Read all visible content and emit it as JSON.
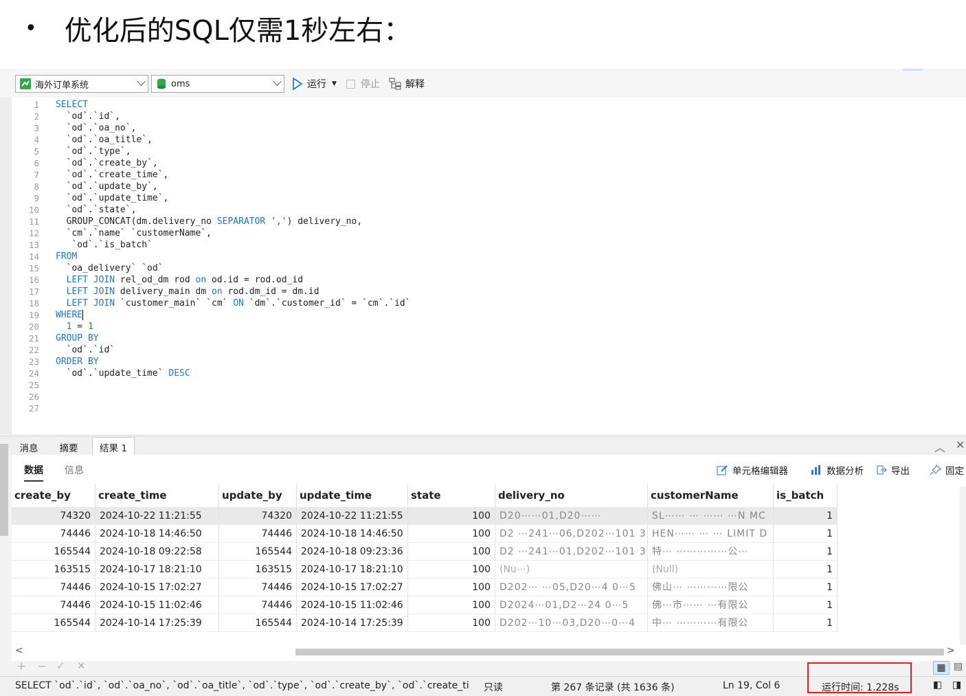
{
  "slide": {
    "bullet": "•",
    "title": "优化后的SQL仅需1秒左右："
  },
  "toolbar": {
    "connection": "海外订单系统",
    "database": "oms",
    "run": "运行",
    "stop": "停止",
    "explain": "解释"
  },
  "editor": {
    "line_numbers": [
      "1",
      "2",
      "3",
      "4",
      "5",
      "6",
      "7",
      "8",
      "9",
      "10",
      "11",
      "12",
      "13",
      "14",
      "15",
      "16",
      "17",
      "18",
      "19",
      "20",
      "21",
      "22",
      "23",
      "24",
      "25",
      "26",
      "27"
    ],
    "lines": [
      [
        {
          "t": "SELECT",
          "c": "kw"
        }
      ],
      [
        {
          "t": "  `od`.`id`,",
          "c": ""
        }
      ],
      [
        {
          "t": "  `od`.`oa_no`,",
          "c": ""
        }
      ],
      [
        {
          "t": "  `od`.`oa_title`,",
          "c": ""
        }
      ],
      [
        {
          "t": "  `od`.`type`,",
          "c": ""
        }
      ],
      [
        {
          "t": "  `od`.`create_by`,",
          "c": ""
        }
      ],
      [
        {
          "t": "  `od`.`create_time`,",
          "c": ""
        }
      ],
      [
        {
          "t": "  `od`.`update_by`,",
          "c": ""
        }
      ],
      [
        {
          "t": "  `od`.`update_time`,",
          "c": ""
        }
      ],
      [
        {
          "t": "  `od`.`state`,",
          "c": ""
        }
      ],
      [
        {
          "t": "  GROUP_CONCAT(dm.delivery_no ",
          "c": ""
        },
        {
          "t": "SEPARATOR",
          "c": "kw"
        },
        {
          "t": " ",
          "c": ""
        },
        {
          "t": "','",
          "c": "str"
        },
        {
          "t": ") delivery_no,",
          "c": ""
        }
      ],
      [
        {
          "t": "  `cm`.`name` `customerName`,",
          "c": ""
        }
      ],
      [
        {
          "t": "   `od`.`is_batch`",
          "c": ""
        }
      ],
      [
        {
          "t": "FROM",
          "c": "kw"
        }
      ],
      [
        {
          "t": "  `oa_delivery` `od`",
          "c": ""
        }
      ],
      [
        {
          "t": "  ",
          "c": ""
        },
        {
          "t": "LEFT JOIN",
          "c": "kw"
        },
        {
          "t": " rel_od_dm rod ",
          "c": ""
        },
        {
          "t": "on",
          "c": "kw"
        },
        {
          "t": " od.id = rod.od_id",
          "c": ""
        }
      ],
      [
        {
          "t": "  ",
          "c": ""
        },
        {
          "t": "LEFT JOIN",
          "c": "kw"
        },
        {
          "t": " delivery_main dm ",
          "c": ""
        },
        {
          "t": "on",
          "c": "kw"
        },
        {
          "t": " rod.dm_id = dm.id",
          "c": ""
        }
      ],
      [
        {
          "t": "  ",
          "c": ""
        },
        {
          "t": "LEFT JOIN",
          "c": "kw"
        },
        {
          "t": " `customer_main` `cm` ",
          "c": ""
        },
        {
          "t": "ON",
          "c": "kw"
        },
        {
          "t": " `dm`.`customer_id` = `cm`.`id`",
          "c": ""
        }
      ],
      [
        {
          "t": "WHERE",
          "c": "kw"
        },
        {
          "t": "",
          "c": "caret"
        }
      ],
      [
        {
          "t": "  ",
          "c": ""
        },
        {
          "t": "1",
          "c": "num"
        },
        {
          "t": " = ",
          "c": ""
        },
        {
          "t": "1",
          "c": "num"
        }
      ],
      [
        {
          "t": "GROUP BY",
          "c": "kw"
        }
      ],
      [
        {
          "t": "  `od`.`id`",
          "c": ""
        }
      ],
      [
        {
          "t": "ORDER BY",
          "c": "kw"
        }
      ],
      [
        {
          "t": "  `od`.`update_time` ",
          "c": ""
        },
        {
          "t": "DESC",
          "c": "kw"
        }
      ],
      [],
      [],
      []
    ]
  },
  "result_tabs": [
    "消息",
    "摘要",
    "结果 1"
  ],
  "sub_tabs": {
    "data": "数据",
    "info": "信息"
  },
  "result_tools": {
    "cell_editor": "单元格编辑器",
    "analysis": "数据分析",
    "export": "导出",
    "pin": "固定"
  },
  "table": {
    "columns": [
      "create_by",
      "create_time",
      "update_by",
      "update_time",
      "state",
      "delivery_no",
      "customerName",
      "is_batch"
    ],
    "rows": [
      [
        "74320",
        "2024-10-22 11:21:55",
        "74320",
        "2024-10-22 11:21:55",
        "100",
        "D20⋯⋯01,D20⋯⋯",
        "SL⋯⋯ ⋯ ⋯⋯ ⋯N MC",
        "1"
      ],
      [
        "74446",
        "2024-10-18 14:46:50",
        "74446",
        "2024-10-18 14:46:50",
        "100",
        "D2 ⋯241⋯06,D202⋯101 3",
        "HEN⋯⋯ ⋯ ⋯ LIMIT D",
        "1"
      ],
      [
        "165544",
        "2024-10-18 09:22:58",
        "165544",
        "2024-10-18 09:23:36",
        "100",
        "D2 ⋯241⋯01,D202⋯101 3",
        "特⋯ ⋯⋯⋯⋯⋯公⋯",
        "1"
      ],
      [
        "163515",
        "2024-10-17 18:21:10",
        "163515",
        "2024-10-17 18:21:10",
        "100",
        "(Nu⋯)",
        "(Null)",
        "1"
      ],
      [
        "74446",
        "2024-10-15 17:02:27",
        "74446",
        "2024-10-15 17:02:27",
        "100",
        "D202⋯ ⋯05,D20⋯4 0⋯5",
        "佛山⋯ ⋯⋯⋯⋯限公",
        "1"
      ],
      [
        "74446",
        "2024-10-15 11:02:46",
        "74446",
        "2024-10-15 11:02:46",
        "100",
        "D2024⋯01,D2⋯24 0⋯5",
        "佛⋯市⋯⋯ ⋯有限公",
        "1"
      ],
      [
        "165544",
        "2024-10-14 17:25:39",
        "165544",
        "2024-10-14 17:25:39",
        "100",
        "D202⋯10⋯03,D20⋯0⋯4",
        "中⋯ ⋯⋯⋯⋯有限公",
        "1"
      ]
    ]
  },
  "status": {
    "sql_preview": "SELECT  `od`.`id`,  `od`.`oa_no`,  `od`.`oa_title`,  `od`.`type`,  `od`.`create_by`,  `od`.`create_ti",
    "readonly": "只读",
    "record": "第 267 条记录 (共 1636 条)",
    "cursor": "Ln 19, Col 6",
    "runtime": "运行时间: 1.228s"
  },
  "colors": {
    "keyword": "#1f76c8",
    "number": "#2a9a2a",
    "string": "#c02020",
    "highlight": "#e02020",
    "run": "#2a7ad5"
  }
}
